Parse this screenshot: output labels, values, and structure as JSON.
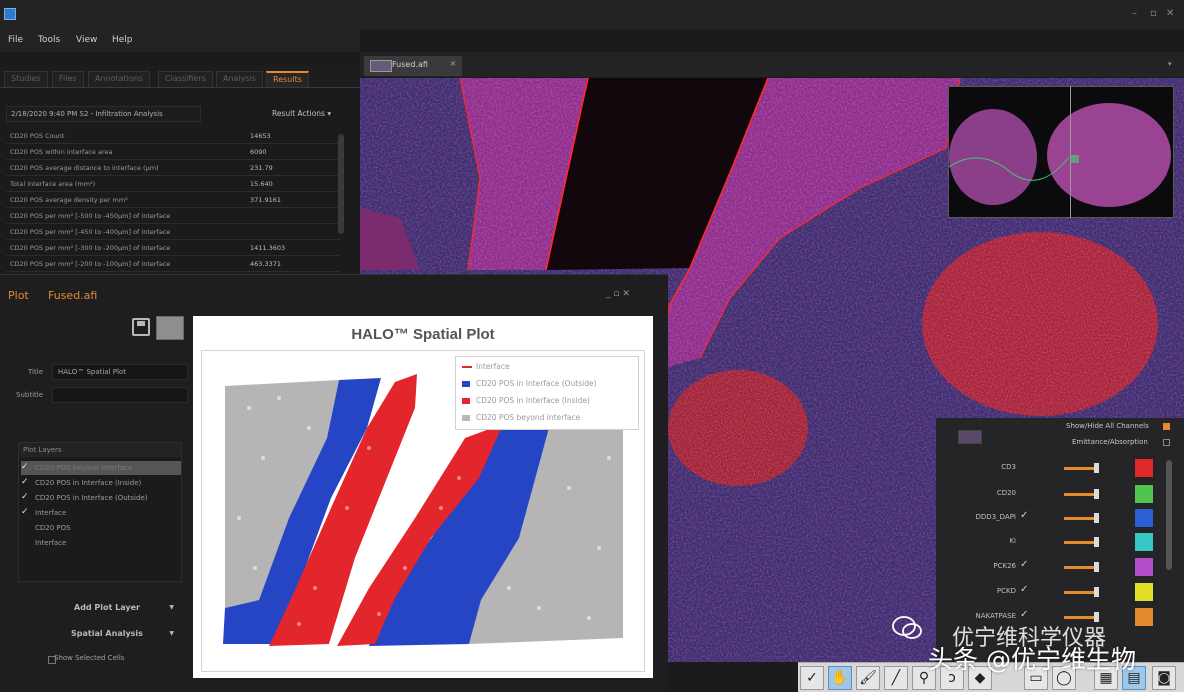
{
  "window": {
    "title": "",
    "controls": [
      "–",
      "▫",
      "✕"
    ]
  },
  "menu": [
    "File",
    "Tools",
    "View",
    "Help"
  ],
  "left_tabs": [
    "Studies",
    "Files",
    "Annotations",
    "Classifiers",
    "Analysis",
    "Results"
  ],
  "analysis": {
    "selected": "2/18/2020 9:40 PM S2 - Infiltration Analysis",
    "result_actions": "Result Actions"
  },
  "results": [
    {
      "label": "CD20 POS Count",
      "value": "14653"
    },
    {
      "label": "CD20 POS within interface area",
      "value": "6090"
    },
    {
      "label": "CD20 POS average distance to interface (µm)",
      "value": "231.79"
    },
    {
      "label": "Total interface area (mm²)",
      "value": "15.640"
    },
    {
      "label": "CD20 POS average density per mm²",
      "value": "371.9161"
    },
    {
      "label": "CD20 POS per mm² [-500 to -450µm] of interface",
      "value": ""
    },
    {
      "label": "CD20 POS per mm² [-450 to -400µm] of interface",
      "value": ""
    },
    {
      "label": "CD20 POS per mm² [-300 to -200µm] of interface",
      "value": "1411.3603"
    },
    {
      "label": "CD20 POS per mm² [-200 to -100µm] of interface",
      "value": "463.3371"
    }
  ],
  "plot_panel": {
    "tab_plot": "Plot",
    "tab_file": "Fused.afi",
    "win_controls": "_  ▫  ✕",
    "title_label": "Title",
    "title_value": "HALO™ Spatial Plot",
    "subtitle_label": "Subtitle",
    "subtitle_value": "",
    "layers_header": "Plot Layers",
    "layers": [
      {
        "label": "CD20 POS beyond interface",
        "checked": true,
        "selected": true
      },
      {
        "label": "CD20 POS in Interface (Inside)",
        "checked": true,
        "selected": false
      },
      {
        "label": "CD20 POS in Interface (Outside)",
        "checked": true,
        "selected": false
      },
      {
        "label": "Interface",
        "checked": true,
        "selected": false
      },
      {
        "label": "CD20 POS",
        "checked": false,
        "selected": false
      },
      {
        "label": "Interface",
        "checked": false,
        "selected": false
      }
    ],
    "add_layer": "Add Plot Layer",
    "spatial_analysis": "Spatial Analysis",
    "show_cells": "Show Selected Cells"
  },
  "spatial_plot": {
    "title": "HALO™ Spatial Plot",
    "legend": [
      {
        "label": "Interface",
        "color": "#e3262b",
        "kind": "line"
      },
      {
        "label": "CD20 POS in Interface (Outside)",
        "color": "#2545c4",
        "kind": "dot"
      },
      {
        "label": "CD20 POS in Interface (Inside)",
        "color": "#e3262b",
        "kind": "dot"
      },
      {
        "label": "CD20 POS beyond interface",
        "color": "#b9b9b9",
        "kind": "dot"
      }
    ]
  },
  "viewer": {
    "tab": "Fused.afi",
    "dropdown": "▾"
  },
  "channels_panel": {
    "show_hide": "Show/Hide All Channels",
    "emit": "Emittance/Absorption",
    "channels": [
      {
        "name": "CD3",
        "checked": false,
        "color": "#e02a2a"
      },
      {
        "name": "CD20",
        "checked": false,
        "color": "#4fc44f"
      },
      {
        "name": "DDD3_DAPI",
        "checked": true,
        "color": "#2c5fd6"
      },
      {
        "name": "Ki",
        "checked": false,
        "color": "#36c7c7"
      },
      {
        "name": "PCK26",
        "checked": true,
        "color": "#b24fc8"
      },
      {
        "name": "PCKD",
        "checked": true,
        "color": "#e0e02a"
      },
      {
        "name": "NAKATPASE",
        "checked": true,
        "color": "#e38a2e"
      }
    ]
  },
  "toolbar": [
    "pointer-check",
    "hand",
    "brush",
    "pen",
    "wand",
    "lasso",
    "fill",
    "rectangle",
    "ellipse",
    "tiles",
    "grid",
    "camera"
  ],
  "watermark": "头条 @优宁维生物",
  "watermark_overlay": "优宁维科学仪器"
}
